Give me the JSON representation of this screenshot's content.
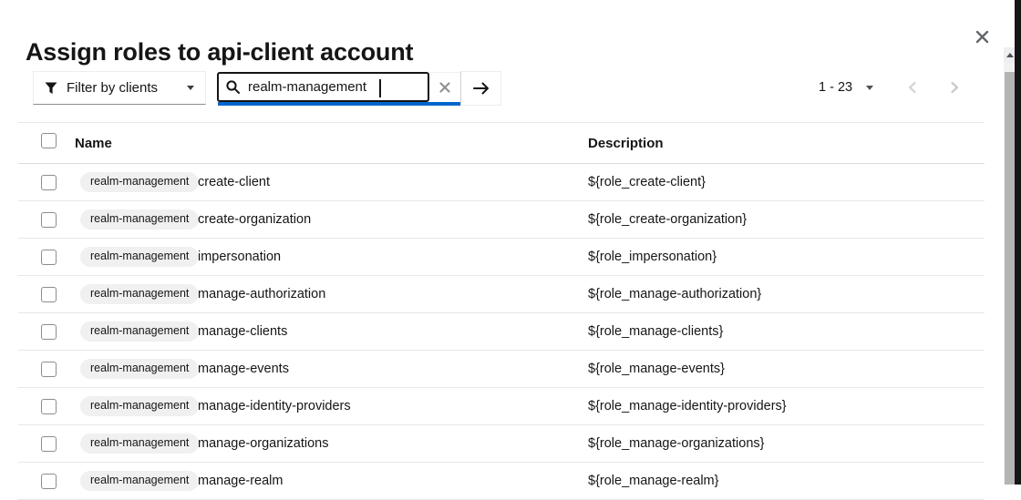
{
  "modal": {
    "title": "Assign roles to api-client account",
    "close_icon": "close-x"
  },
  "toolbar": {
    "filter": {
      "label": "Filter by clients",
      "icon": "funnel",
      "caret_icon": "caret-down"
    },
    "search": {
      "value": "realm-management",
      "placeholder": "",
      "icon": "magnifier",
      "clear_icon": "close-x",
      "submit_icon": "arrow-right"
    },
    "pagination": {
      "range": "1 - 23",
      "caret_icon": "caret-down",
      "prev_icon": "chevron-left",
      "next_icon": "chevron-right"
    }
  },
  "table": {
    "headers": {
      "name": "Name",
      "description": "Description"
    },
    "rows": [
      {
        "badge": "realm-management",
        "name": "create-client",
        "description": "${role_create-client}"
      },
      {
        "badge": "realm-management",
        "name": "create-organization",
        "description": "${role_create-organization}"
      },
      {
        "badge": "realm-management",
        "name": "impersonation",
        "description": "${role_impersonation}"
      },
      {
        "badge": "realm-management",
        "name": "manage-authorization",
        "description": "${role_manage-authorization}"
      },
      {
        "badge": "realm-management",
        "name": "manage-clients",
        "description": "${role_manage-clients}"
      },
      {
        "badge": "realm-management",
        "name": "manage-events",
        "description": "${role_manage-events}"
      },
      {
        "badge": "realm-management",
        "name": "manage-identity-providers",
        "description": "${role_manage-identity-providers}"
      },
      {
        "badge": "realm-management",
        "name": "manage-organizations",
        "description": "${role_manage-organizations}"
      },
      {
        "badge": "realm-management",
        "name": "manage-realm",
        "description": "${role_manage-realm}"
      }
    ]
  },
  "colors": {
    "accent": "#0066cc",
    "text": "#151515",
    "badge_bg": "#f0f0f0",
    "border": "#e7e7e9",
    "disabled_icon": "#d2d5d8"
  }
}
